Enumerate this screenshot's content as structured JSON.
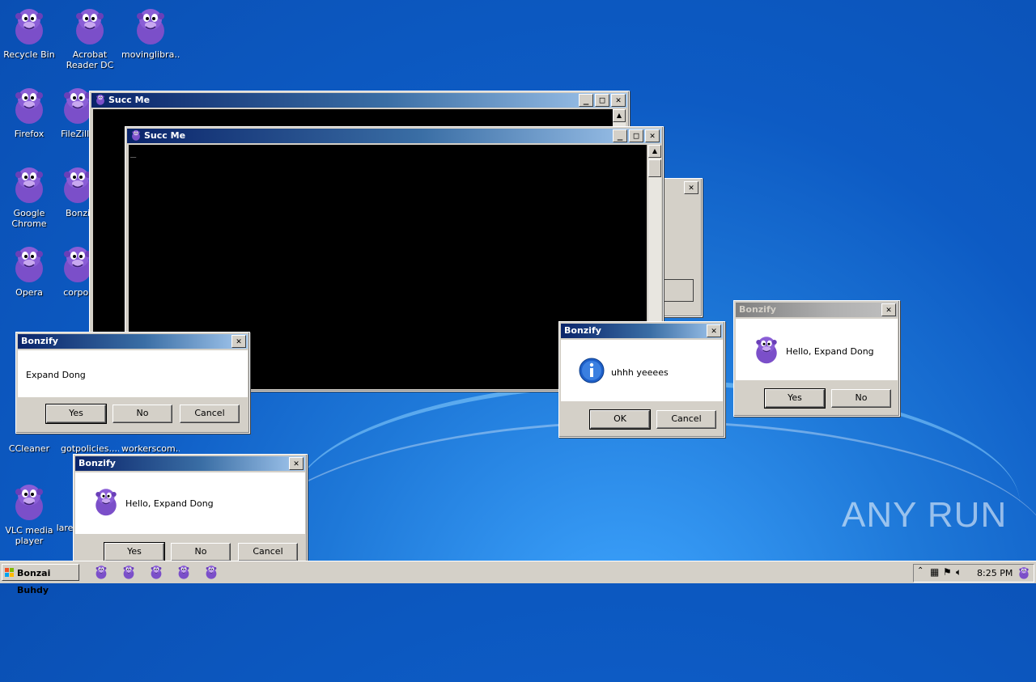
{
  "desktop": {
    "icons": [
      {
        "label": "Recycle Bin"
      },
      {
        "label": "Acrobat Reader DC"
      },
      {
        "label": "movinglibra..."
      },
      {
        "label": "Firefox"
      },
      {
        "label": "FileZilla"
      },
      {
        "label": "Google Chrome"
      },
      {
        "label": "Bonzi"
      },
      {
        "label": "Opera"
      },
      {
        "label": "corpor"
      },
      {
        "label": "CCleaner"
      },
      {
        "label": "gotpolicies...."
      },
      {
        "label": "workerscom..."
      },
      {
        "label": "VLC media player"
      },
      {
        "label": "lare"
      }
    ]
  },
  "console_back": {
    "title": "Succ Me"
  },
  "console_front": {
    "title": "Succ Me",
    "cursor": "_"
  },
  "dialog_left": {
    "title": "Bonzify",
    "message": "Expand Dong",
    "yes": "Yes",
    "no": "No",
    "cancel": "Cancel"
  },
  "dialog_bottom": {
    "title": "Bonzify",
    "message": "Hello, Expand Dong",
    "yes": "Yes",
    "no": "No",
    "cancel": "Cancel"
  },
  "dialog_info": {
    "title": "Bonzify",
    "message": "uhhh yeeees",
    "ok": "OK",
    "cancel": "Cancel"
  },
  "dialog_right": {
    "title": "Bonzify",
    "message": "Hello, Expand Dong",
    "yes": "Yes",
    "no": "No"
  },
  "taskbar": {
    "start_label": "Bonzai Buhdy",
    "clock": "8:25 PM",
    "quick_launch_count": 5
  },
  "watermark": "ANY RUN",
  "colors": {
    "title_active": "#0a246a",
    "title_gradient_end": "#a6caf0",
    "desktop_blue": "#1e78d8",
    "bonzi_purple": "#7b4fc9"
  }
}
